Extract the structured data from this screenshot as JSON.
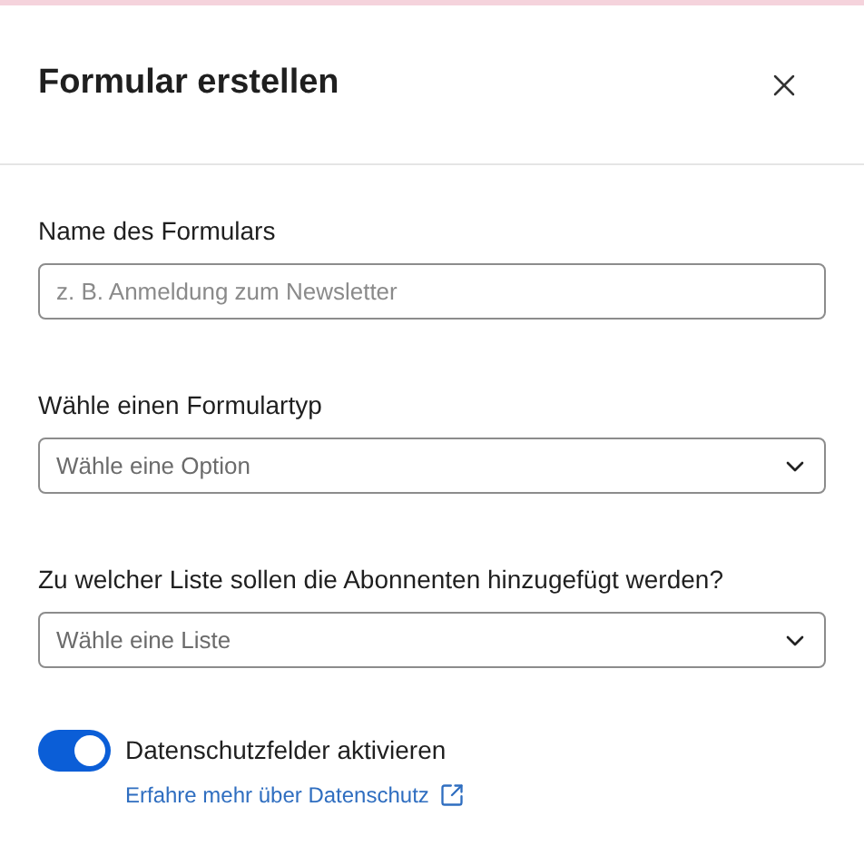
{
  "dialog": {
    "title": "Formular erstellen"
  },
  "fields": [
    {
      "kind": "text",
      "label": "Name des Formulars",
      "placeholder": "z. B. Anmeldung zum Newsletter"
    },
    {
      "kind": "select",
      "label": "Wähle einen Formulartyp",
      "placeholder": "Wähle eine Option"
    },
    {
      "kind": "select",
      "label": "Zu welcher Liste sollen die Abonnenten hinzugefügt werden?",
      "placeholder": "Wähle eine Liste"
    }
  ],
  "privacy": {
    "label": "Datenschutzfelder aktivieren",
    "on": true,
    "link": "Erfahre mehr über Datenschutz"
  }
}
